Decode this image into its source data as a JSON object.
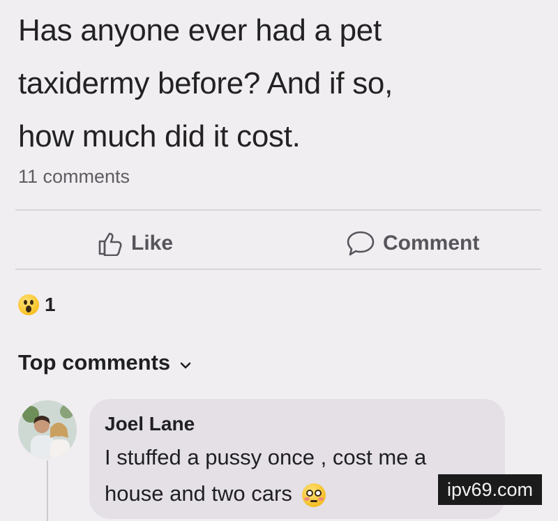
{
  "post": {
    "lines": [
      "Has anyone ever had a pet",
      "taxidermy before? And if so,",
      "how much did it cost."
    ],
    "comment_count": "11 comments"
  },
  "actions": {
    "like_label": "Like",
    "comment_label": "Comment"
  },
  "reactions": {
    "count": "1",
    "icon": "wow-emoji"
  },
  "top_comments": {
    "label": "Top comments",
    "icon": "chevron-down-icon"
  },
  "comment": {
    "author": "Joel Lane",
    "line1": "I stuffed a pussy once , cost me a",
    "line2": "house and two cars",
    "emoji": "flushed-emoji"
  },
  "watermark": {
    "text": "ipv69.com"
  },
  "colors": {
    "background": "#f1eef2",
    "bubble": "#e4e0e6",
    "muted_text": "#57555b",
    "watermark_bg": "#1b1b1b"
  }
}
